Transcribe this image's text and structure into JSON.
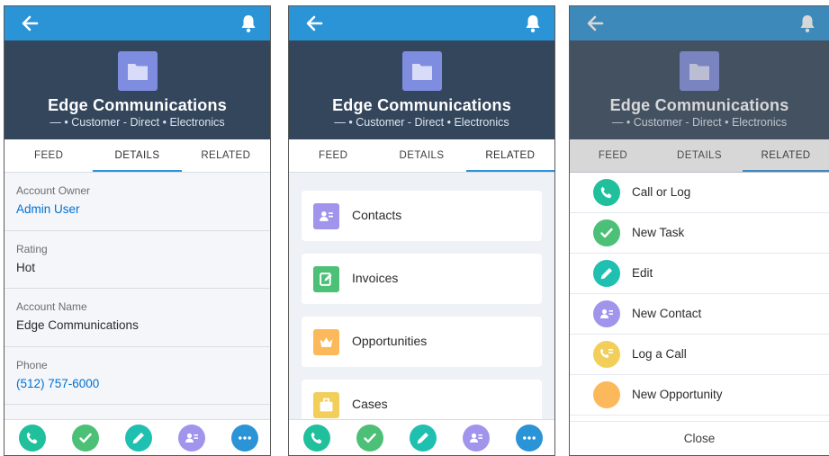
{
  "account": {
    "name": "Edge Communications",
    "subtitle": "— • Customer - Direct • Electronics"
  },
  "tabs": {
    "feed": "FEED",
    "details": "DETAILS",
    "related": "RELATED"
  },
  "details": [
    {
      "label": "Account Owner",
      "value": "Admin User",
      "link": true
    },
    {
      "label": "Rating",
      "value": "Hot",
      "link": false
    },
    {
      "label": "Account Name",
      "value": "Edge Communications",
      "link": false
    },
    {
      "label": "Phone",
      "value": "(512) 757-6000",
      "link": true
    }
  ],
  "related": [
    {
      "label": "Contacts",
      "icon": "contact-icon",
      "color": "#a094ed"
    },
    {
      "label": "Invoices",
      "icon": "invoice-icon",
      "color": "#4bc076"
    },
    {
      "label": "Opportunities",
      "icon": "crown-icon",
      "color": "#fcb95b"
    },
    {
      "label": "Cases",
      "icon": "briefcase-icon",
      "color": "#f2cf5b"
    }
  ],
  "actions": [
    {
      "label": "Call or Log",
      "icon": "phone-icon",
      "color": "#1fc09b"
    },
    {
      "label": "New Task",
      "icon": "check-icon",
      "color": "#4bc076"
    },
    {
      "label": "Edit",
      "icon": "pencil-icon",
      "color": "#1fc0b0"
    },
    {
      "label": "New Contact",
      "icon": "contact-icon",
      "color": "#a094ed"
    },
    {
      "label": "Log a Call",
      "icon": "log-call-icon",
      "color": "#f2cf5b"
    },
    {
      "label": "New Opportunity",
      "icon": "circle-icon",
      "color": "#fcb95b"
    }
  ],
  "close_label": "Close",
  "colors": {
    "brand": "#2a94d6",
    "header": "#34465c",
    "more": "#2a94d6"
  }
}
